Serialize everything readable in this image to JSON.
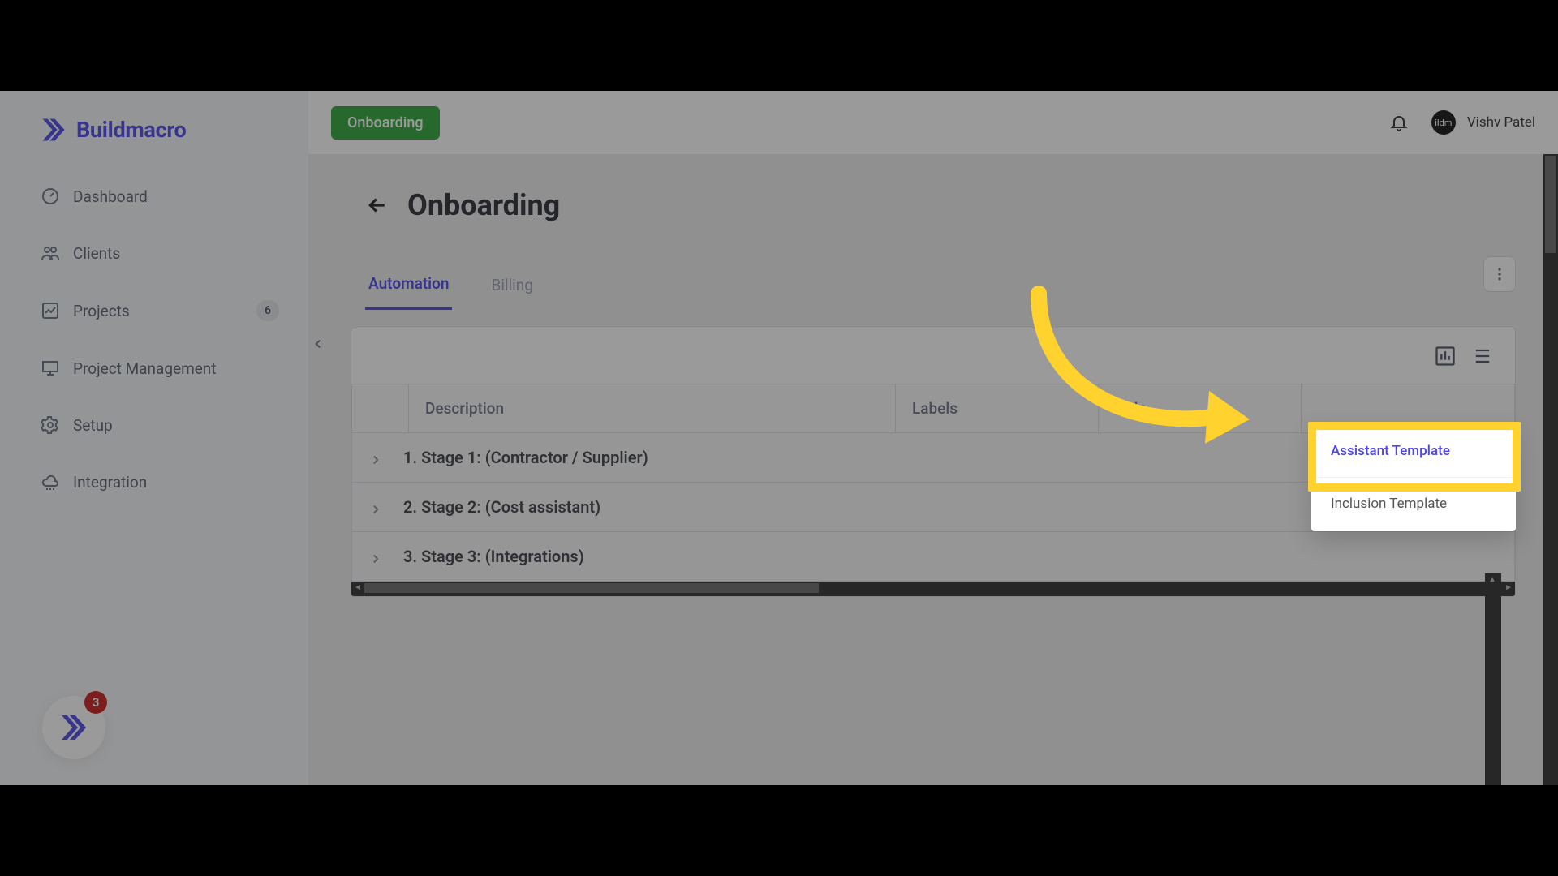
{
  "brand": {
    "name": "Buildmacro"
  },
  "sidebar": {
    "items": [
      {
        "label": "Dashboard"
      },
      {
        "label": "Clients"
      },
      {
        "label": "Projects",
        "badge": "6"
      },
      {
        "label": "Project Management"
      },
      {
        "label": "Setup"
      },
      {
        "label": "Integration"
      }
    ],
    "float_badge_count": "3"
  },
  "topbar": {
    "chip_label": "Onboarding",
    "user_name": "Vishv Patel",
    "avatar_text": "ildm"
  },
  "page": {
    "title": "Onboarding",
    "tabs": [
      {
        "label": "Automation",
        "active": true
      },
      {
        "label": "Billing",
        "active": false
      }
    ]
  },
  "table": {
    "columns": {
      "description": "Description",
      "labels": "Labels",
      "help": "Help"
    },
    "rows": [
      {
        "text": "1. Stage 1: (Contractor / Supplier)"
      },
      {
        "text": "2. Stage 2: (Cost assistant)"
      },
      {
        "text": "3. Stage 3: (Integrations)"
      }
    ]
  },
  "popup": {
    "items": [
      {
        "label": "Assistant Template",
        "primary": true
      },
      {
        "label": "Inclusion Template",
        "primary": false
      }
    ]
  }
}
